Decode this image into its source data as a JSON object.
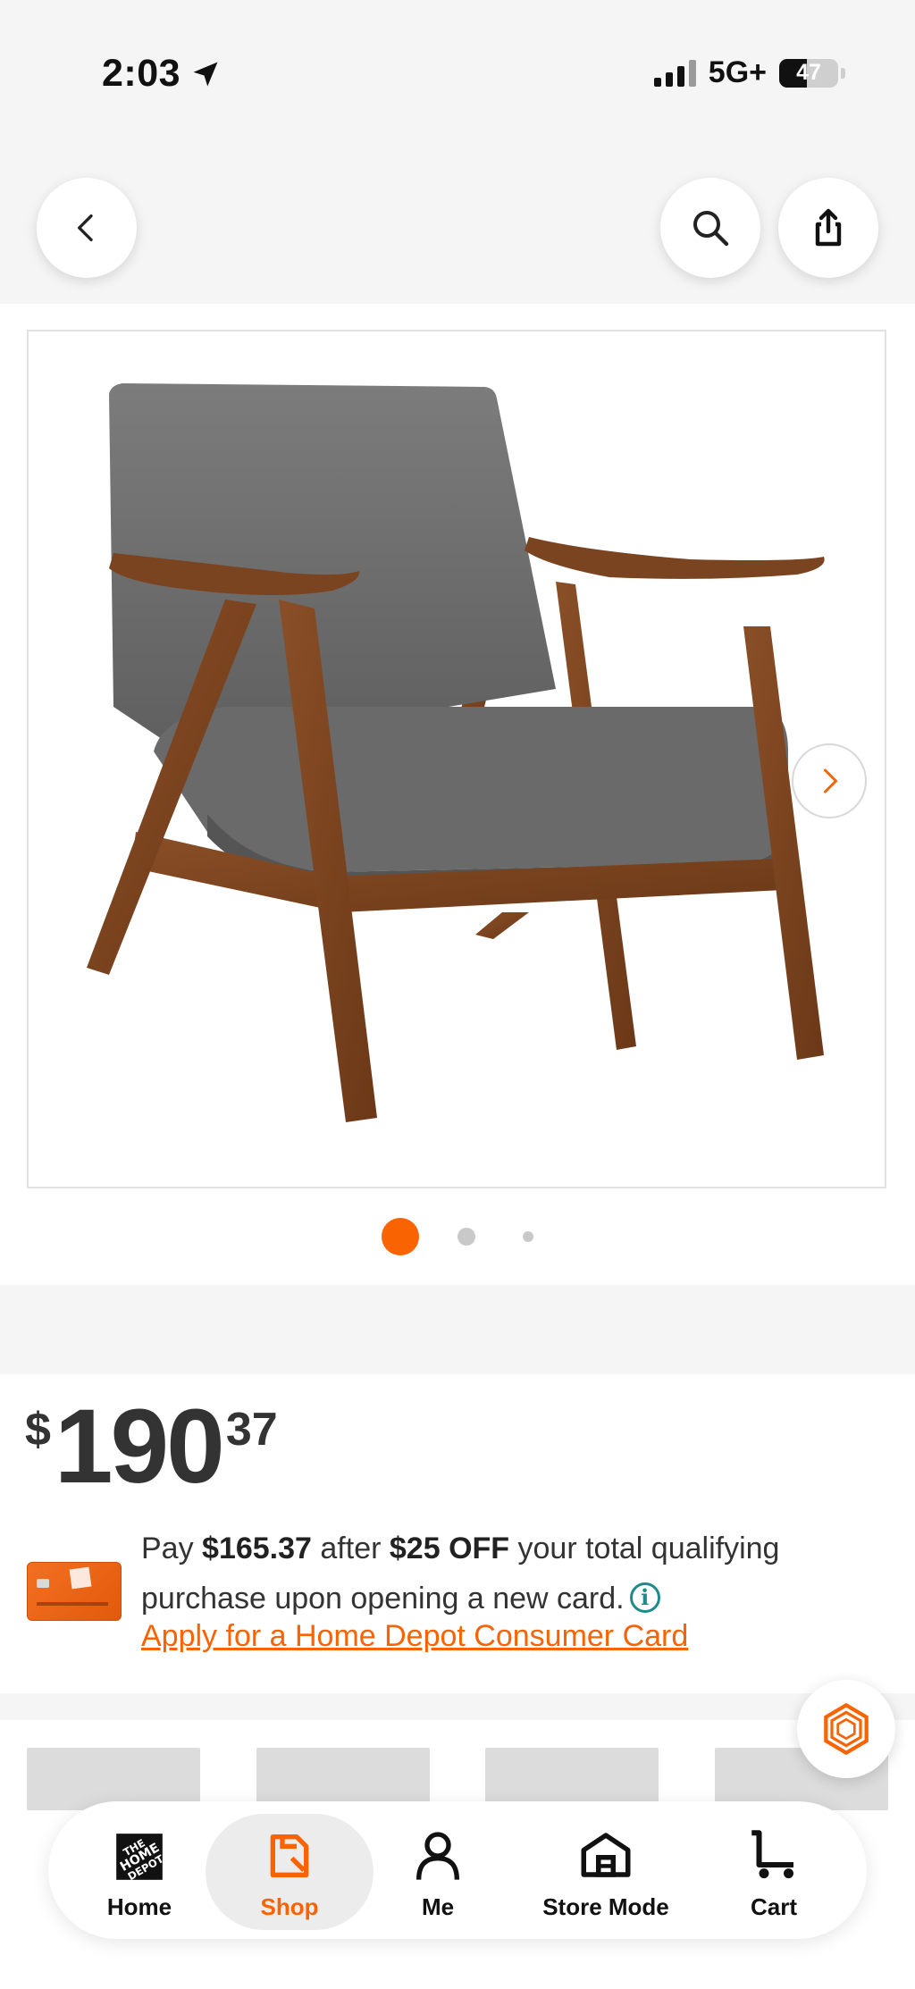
{
  "status_bar": {
    "time": "2:03",
    "network": "5G+",
    "battery": "47",
    "battery_level": 0.47
  },
  "header": {
    "back_icon": "chevron-left-icon",
    "search_icon": "search-icon",
    "share_icon": "share-icon"
  },
  "gallery": {
    "image_alt": "Gray upholstered accent chair with walnut wood frame",
    "dot_count": 3,
    "active_index": 0
  },
  "price": {
    "currency": "$",
    "dollars": "190",
    "cents": "37"
  },
  "promo": {
    "pay": "Pay ",
    "discounted_price": "$165.37",
    "after": " after ",
    "discount": "$25 OFF",
    "rest": " your total qualifying purchase upon opening a new card.",
    "link": "Apply for a Home Depot Consumer Card"
  },
  "nav": {
    "items": [
      {
        "label": "Home",
        "icon": "home-depot-logo-icon"
      },
      {
        "label": "Shop",
        "icon": "shop-icon",
        "active": true
      },
      {
        "label": "Me",
        "icon": "person-icon"
      },
      {
        "label": "Store Mode",
        "icon": "store-icon"
      },
      {
        "label": "Cart",
        "icon": "cart-icon"
      }
    ]
  },
  "colors": {
    "brand_orange": "#f96302",
    "info_teal": "#1f8a8a"
  }
}
